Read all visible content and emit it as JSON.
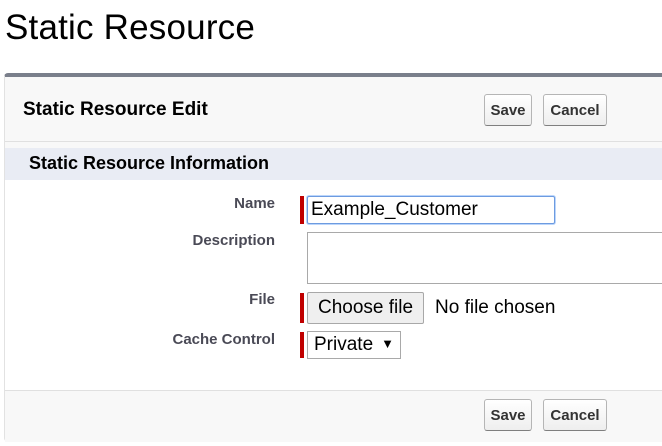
{
  "page": {
    "title": "Static Resource"
  },
  "edit_panel": {
    "heading": "Static Resource Edit",
    "save_label": "Save",
    "cancel_label": "Cancel"
  },
  "section": {
    "title": "Static Resource Information"
  },
  "fields": {
    "name": {
      "label": "Name",
      "value": "Example_Customer",
      "required": true
    },
    "description": {
      "label": "Description",
      "value": ""
    },
    "file": {
      "label": "File",
      "button_label": "Choose file",
      "status": "No file chosen",
      "required": true
    },
    "cache_control": {
      "label": "Cache Control",
      "selected": "Private",
      "arrow": "▼",
      "required": true
    }
  },
  "colors": {
    "required_marker": "#c00000",
    "section_background": "#e9ecf4",
    "panel_border": "#7a7f8b"
  }
}
